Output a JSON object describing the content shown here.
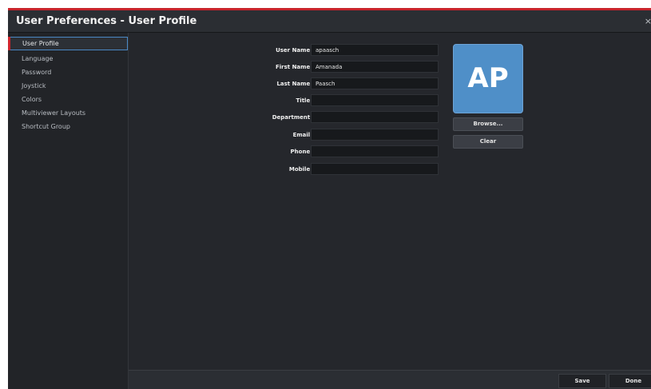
{
  "window": {
    "title": "User Preferences - User Profile",
    "close_glyph": "×"
  },
  "sidebar": {
    "items": [
      {
        "label": "User Profile",
        "active": true
      },
      {
        "label": "Language"
      },
      {
        "label": "Password"
      },
      {
        "label": "Joystick"
      },
      {
        "label": "Colors"
      },
      {
        "label": "Multiviewer Layouts"
      },
      {
        "label": "Shortcut Group"
      }
    ]
  },
  "form": {
    "username": {
      "label": "User Name:",
      "value": "apaasch"
    },
    "first_name": {
      "label": "First Name:",
      "value": "Amanada"
    },
    "last_name": {
      "label": "Last Name:",
      "value": "Paasch"
    },
    "title": {
      "label": "Title:",
      "value": ""
    },
    "department": {
      "label": "Department:",
      "value": ""
    },
    "email": {
      "label": "Email:",
      "value": ""
    },
    "phone": {
      "label": "Phone:",
      "value": ""
    },
    "mobile": {
      "label": "Mobile:",
      "value": ""
    }
  },
  "avatar": {
    "initials": "AP",
    "color": "#4f8fc8",
    "browse_label": "Browse...",
    "clear_label": "Clear"
  },
  "footer": {
    "save_label": "Save",
    "done_label": "Done"
  },
  "colors": {
    "accent_red": "#c8242c",
    "selection_blue": "#4a88c4"
  }
}
